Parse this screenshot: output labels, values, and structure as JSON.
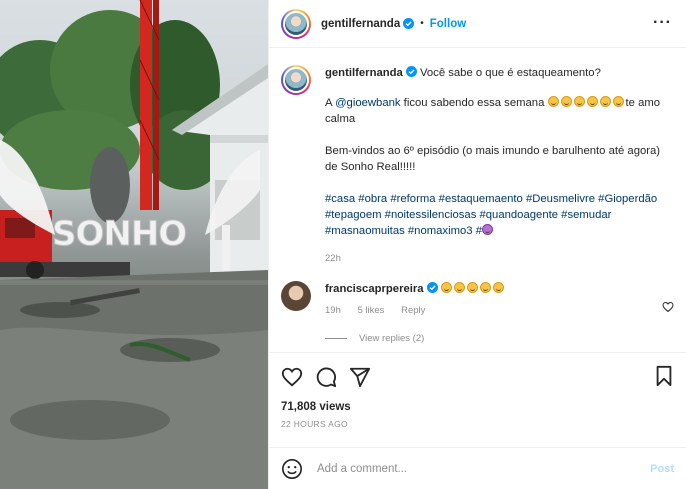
{
  "header": {
    "username": "gentilfernanda",
    "follow_label": "Follow",
    "separator": "•"
  },
  "caption": {
    "username": "gentilfernanda",
    "line1": "Você sabe o que é estaqueamento?",
    "line2_a": "A ",
    "mention": "@gioewbank",
    "line2_b": " ficou sabendo essa semana ",
    "line2_c": "te amo calma",
    "line3": "Bem-vindos ao 6º episódio (o mais imundo e barulhento até agora) de Sonho Real!!!!!",
    "hashtags": "#casa #obra #reforma #estaquemaento #Deusmelivre #Gioperdão #tepagoem #noitessilenciosas #quandoagente #semudar #masnaomuitas #nomaximo3 #",
    "time": "22h"
  },
  "reply": {
    "username": "franciscaprpereira",
    "time": "19h",
    "likes": "5 likes",
    "reply_label": "Reply",
    "view_replies": "View replies (2)"
  },
  "stats": {
    "views": "71,808 views",
    "date": "22 HOURS AGO"
  },
  "composer": {
    "placeholder": "Add a comment...",
    "post_label": "Post"
  },
  "media": {
    "sign_text": "SONHO"
  },
  "colors": {
    "link_blue": "#0095f6",
    "hashtag_blue": "#00376b",
    "muted": "#8e8e8e",
    "post_disabled": "#b2dffc"
  },
  "icons": [
    "verified-icon",
    "more-icon",
    "heart-icon",
    "comment-icon",
    "share-icon",
    "bookmark-icon",
    "emoji-icon"
  ]
}
